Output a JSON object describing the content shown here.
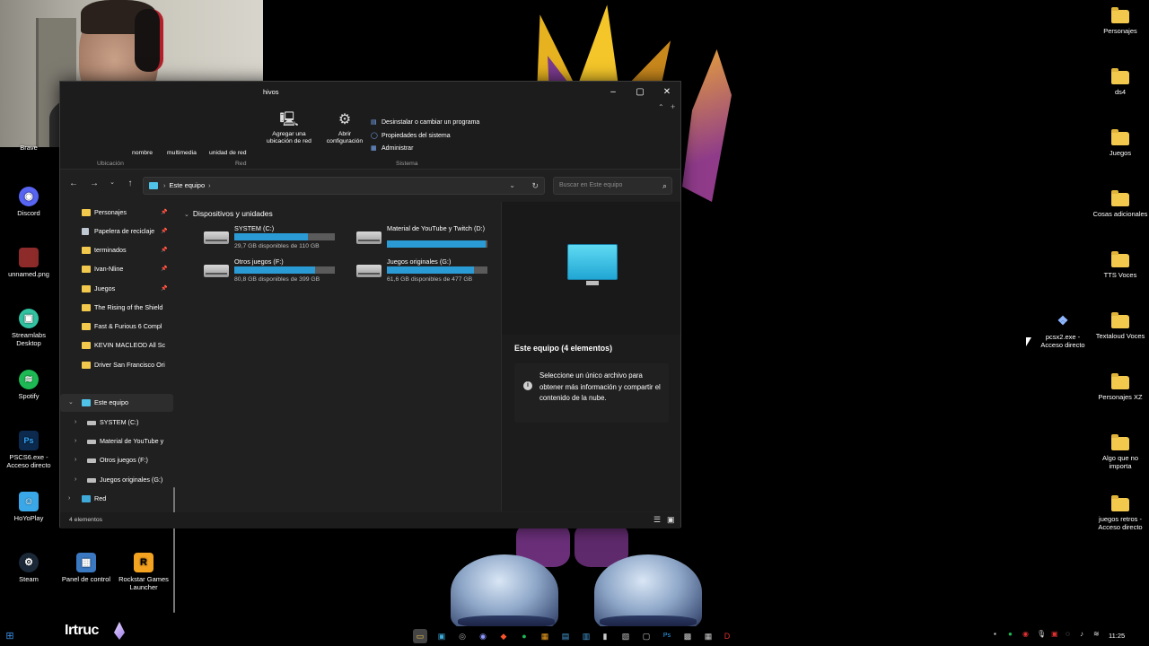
{
  "explorer": {
    "title": "hivos",
    "ribbon": {
      "cut_labels": [
        "nombre",
        "multimedia",
        "unidad de red"
      ],
      "add_network_location": "Agregar una ubicación de red",
      "open_settings": "Abrir configuración",
      "uninstall": "Desinstalar o cambiar un programa",
      "system_properties": "Propiedades del sistema",
      "manage": "Administrar",
      "group_location": "Ubicación",
      "group_network": "Red",
      "group_system": "Sistema"
    },
    "address_path": "Este equipo",
    "search_placeholder": "Buscar en Este equipo",
    "nav": {
      "quick_access": [
        {
          "label": "Personajes",
          "icon": "folder-icon"
        },
        {
          "label": "Papelera de reciclaje",
          "icon": "recycle-bin-icon"
        },
        {
          "label": "terminados",
          "icon": "folder-icon"
        },
        {
          "label": "Ivan-Nline",
          "icon": "folder-icon"
        },
        {
          "label": "Juegos",
          "icon": "folder-icon"
        },
        {
          "label": "The Rising of the Shield",
          "icon": "folder-icon"
        },
        {
          "label": "Fast & Furious 6 Compl",
          "icon": "folder-icon"
        },
        {
          "label": "KEVIN MACLEOD All Sc",
          "icon": "folder-icon"
        },
        {
          "label": "Driver San Francisco Ori",
          "icon": "folder-icon"
        }
      ],
      "this_pc": "Este equipo",
      "drives": [
        "SYSTEM (C:)",
        "Material de YouTube y",
        "Otros juegos (F:)",
        "Juegos originales (G:)"
      ],
      "network": "Red"
    },
    "section_title": "Dispositivos y unidades",
    "drives": [
      {
        "name": "SYSTEM (C:)",
        "free": "29,7 GB disponibles de 110 GB",
        "used_fraction": 0.73
      },
      {
        "name": "Material de YouTube y Twitch (D:)",
        "free": "",
        "used_fraction": 0.98
      },
      {
        "name": "Otros juegos (F:)",
        "free": "80,8 GB disponibles de 399 GB",
        "used_fraction": 0.8
      },
      {
        "name": "Juegos originales (G:)",
        "free": "61,6 GB disponibles de 477 GB",
        "used_fraction": 0.87
      }
    ],
    "details": {
      "title": "Este equipo (4 elementos)",
      "message": "Seleccione un único archivo para obtener más información y compartir el contenido de la nube."
    },
    "status": "4 elementos"
  },
  "desktop_left": [
    {
      "label": "Brave"
    },
    {
      "label": "Discord"
    },
    {
      "label": "unnamed.png"
    },
    {
      "label": "Streamlabs Desktop"
    },
    {
      "label": "Spotify"
    },
    {
      "label": "PSCS6.exe - Acceso directo"
    },
    {
      "label": "HoYoPlay"
    },
    {
      "label": "Steam"
    },
    {
      "label": "Panel de control"
    },
    {
      "label": "Rockstar Games Launcher"
    }
  ],
  "desktop_right": [
    {
      "label": "Personajes"
    },
    {
      "label": "ds4"
    },
    {
      "label": "Juegos"
    },
    {
      "label": "Cosas adicionales"
    },
    {
      "label": "TTS Voces"
    },
    {
      "label": "Textaloud Voces"
    },
    {
      "label": "pcsx2.exe - Acceso directo"
    },
    {
      "label": "Personajes XZ"
    },
    {
      "label": "Algo que no importa"
    },
    {
      "label": "juegos retros - Acceso directo"
    }
  ],
  "overlay": {
    "name": "Irtruc"
  },
  "taskbar": {
    "time": "11:25"
  },
  "colors": {
    "accent": "#2b9bd6",
    "folder": "#f2c94c",
    "window_bg": "#202020"
  }
}
